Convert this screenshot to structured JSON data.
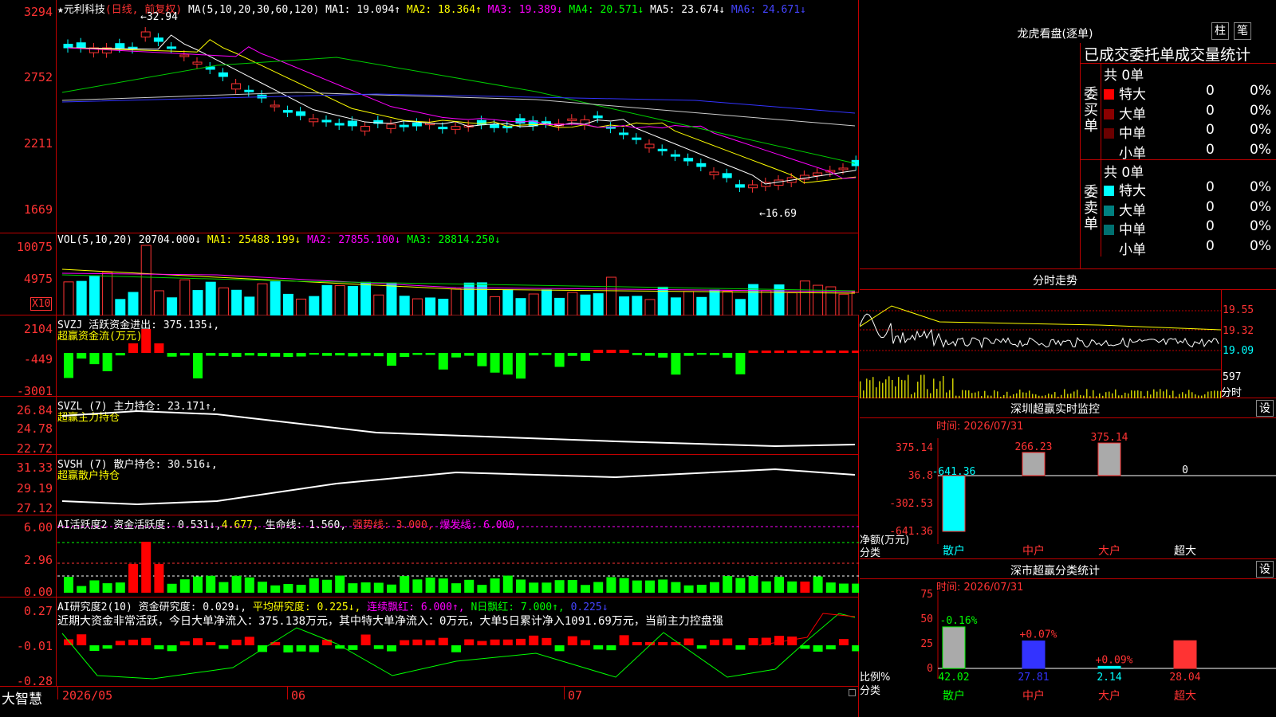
{
  "stock": {
    "name": "★元利科技",
    "period": "(日线, 前复权)"
  },
  "ma_header": {
    "label": "MA(5,10,20,30,60,120)",
    "ma1": "MA1: 19.094↑",
    "ma2": "MA2: 18.364↑",
    "ma3": "MA3: 19.389↓",
    "ma4": "MA4: 20.571↓",
    "ma5": "MA5: 23.674↓",
    "ma6": "MA6: 24.671↓"
  },
  "price_axis": [
    "3294",
    "2752",
    "2211",
    "1669"
  ],
  "price_annot": {
    "high": "←32.94",
    "low": "←16.69"
  },
  "vol_header": {
    "label": "VOL(5,10,20)",
    "value": "20704.000↓",
    "ma1": "MA1: 25488.199↓",
    "ma2": "MA2: 27855.100↓",
    "ma3": "MA3: 28814.250↓"
  },
  "vol_axis": [
    "10075",
    "4975"
  ],
  "vol_unit": "X10",
  "svzj": {
    "label": "SVZJ  活跃资金进出: 375.135↓,",
    "sub": "超赢资金流(万元)",
    "axis": [
      "2104",
      "-449",
      "-3001"
    ]
  },
  "svzl": {
    "label": "SVZL (7) 主力持仓: 23.171↑,",
    "sub": "超赢主力持仓",
    "axis": [
      "26.84",
      "24.78",
      "22.72"
    ]
  },
  "svsh": {
    "label": "SVSH (7) 散户持仓: 30.516↓,",
    "sub": "超赢散户持仓",
    "axis": [
      "31.33",
      "29.19",
      "27.12"
    ]
  },
  "ai1": {
    "label": "AI活跃度2 资金活跃度: 0.531↓,",
    "v2": "4.677,",
    "v3": "生命线: 1.560,",
    "v4": "强势线: 3.000,",
    "v5": "爆发线: 6.000,",
    "axis": [
      "6.00",
      "2.96",
      "0.00"
    ]
  },
  "ai2": {
    "label": "AI研究度2(10) 资金研究度: 0.029↓,",
    "v2": "平均研究度: 0.225↓,",
    "v3": "连续飘红: 6.000↑,",
    "v4": "N日飘红: 7.000↑,",
    "v5": "0.225↓",
    "desc": "近期大资金非常活跃，今日大单净流入：375.138万元，其中特大单净流入：0万元，大单5日累计净入1091.69万元，当前主力控盘强",
    "axis": [
      "0.27",
      "-0.01",
      "-0.28"
    ]
  },
  "dates": [
    "2026/05",
    "06",
    "07"
  ],
  "brand": "大智慧",
  "lhb": {
    "title": "龙虎看盘(逐单)",
    "btn1": "柱",
    "btn2": "笔",
    "subtitle": "已成交委托单成交量统计",
    "buy_label": "委买单",
    "sell_label": "委卖单",
    "buy_total": "共 0单",
    "sell_total": "共 0单",
    "buy_rows": [
      {
        "name": "特大",
        "v": "0",
        "p": "0%",
        "color": "#ff0000"
      },
      {
        "name": "大单",
        "v": "0",
        "p": "0%",
        "color": "#8b0000"
      },
      {
        "name": "中单",
        "v": "0",
        "p": "0%",
        "color": "#6b0000"
      },
      {
        "name": "小单",
        "v": "0",
        "p": "0%",
        "color": "#000"
      }
    ],
    "sell_rows": [
      {
        "name": "特大",
        "v": "0",
        "p": "0%",
        "color": "#00ffff"
      },
      {
        "name": "大单",
        "v": "0",
        "p": "0%",
        "color": "#008080"
      },
      {
        "name": "中单",
        "v": "0",
        "p": "0%",
        "color": "#007070"
      },
      {
        "name": "小单",
        "v": "0",
        "p": "0%",
        "color": "#000"
      }
    ]
  },
  "fenshi": {
    "title": "分时走势",
    "axis": [
      "19.55",
      "19.32",
      "19.09"
    ],
    "vol": "597",
    "vol_label": "分时"
  },
  "monitor": {
    "title": "深圳超赢实时监控",
    "btn": "设",
    "time": "时间: 2026/07/31",
    "axis": [
      "375.14",
      "36.8",
      "-302.53",
      "-641.36"
    ],
    "ylabel": "净额(万元)",
    "xlabel": "分类",
    "cats": [
      "散户",
      "中户",
      "大户",
      "超大"
    ],
    "values": [
      "-641.36",
      "266.23",
      "375.14",
      "0"
    ]
  },
  "stats": {
    "title": "深市超赢分类统计",
    "btn": "设",
    "time": "时间: 2026/07/31",
    "axis": [
      "75",
      "50",
      "25",
      "0"
    ],
    "ylabel": "比例%",
    "xlabel": "分类",
    "cats": [
      "散户",
      "中户",
      "大户",
      "超大"
    ],
    "values": [
      "42.02",
      "27.81",
      "2.14",
      "28.04"
    ],
    "changes": [
      "-0.16%",
      "+0.07%",
      "+0.09%",
      ""
    ]
  }
}
